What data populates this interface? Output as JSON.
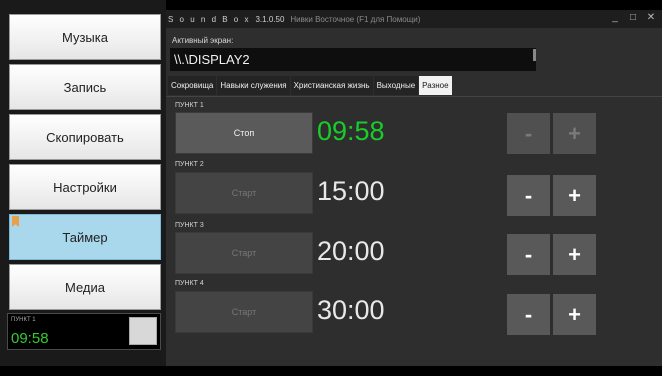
{
  "sidebar": {
    "buttons": [
      {
        "label": "Музыка"
      },
      {
        "label": "Запись"
      },
      {
        "label": "Скопировать"
      },
      {
        "label": "Настройки"
      },
      {
        "label": "Таймер"
      },
      {
        "label": "Медиа"
      }
    ],
    "active_index": 4,
    "mini_timer": {
      "label": "ПУНКТ 1",
      "time": "09:58"
    }
  },
  "window": {
    "app_name": "S o u n d B o x",
    "version": "3.1.0.50",
    "user_hint": "Нивки Восточное   (F1 для Помощи)",
    "controls": {
      "minimize": "_",
      "maximize": "□",
      "close": "✕"
    }
  },
  "active_screen": {
    "label": "Активный экран:",
    "value": "\\\\.\\DISPLAY2"
  },
  "tabs": [
    {
      "label": "Сокровища"
    },
    {
      "label": "Навыки служения"
    },
    {
      "label": "Христианская жизнь"
    },
    {
      "label": "Выходные"
    },
    {
      "label": "Разное"
    }
  ],
  "active_tab": "Разное",
  "items": [
    {
      "label": "ПУНКТ 1",
      "button": "Стоп",
      "time": "09:58",
      "minus": "-",
      "plus": "+"
    },
    {
      "label": "ПУНКТ 2",
      "button": "Старт",
      "time": "15:00",
      "minus": "-",
      "plus": "+"
    },
    {
      "label": "ПУНКТ 3",
      "button": "Старт",
      "time": "20:00",
      "minus": "-",
      "plus": "+"
    },
    {
      "label": "ПУНКТ 4",
      "button": "Старт",
      "time": "30:00",
      "minus": "-",
      "plus": "+"
    }
  ],
  "colors": {
    "running_time": "#19cc2a",
    "active_sidebar": "#a9d7ec",
    "bookmark": "#e8a14a"
  }
}
